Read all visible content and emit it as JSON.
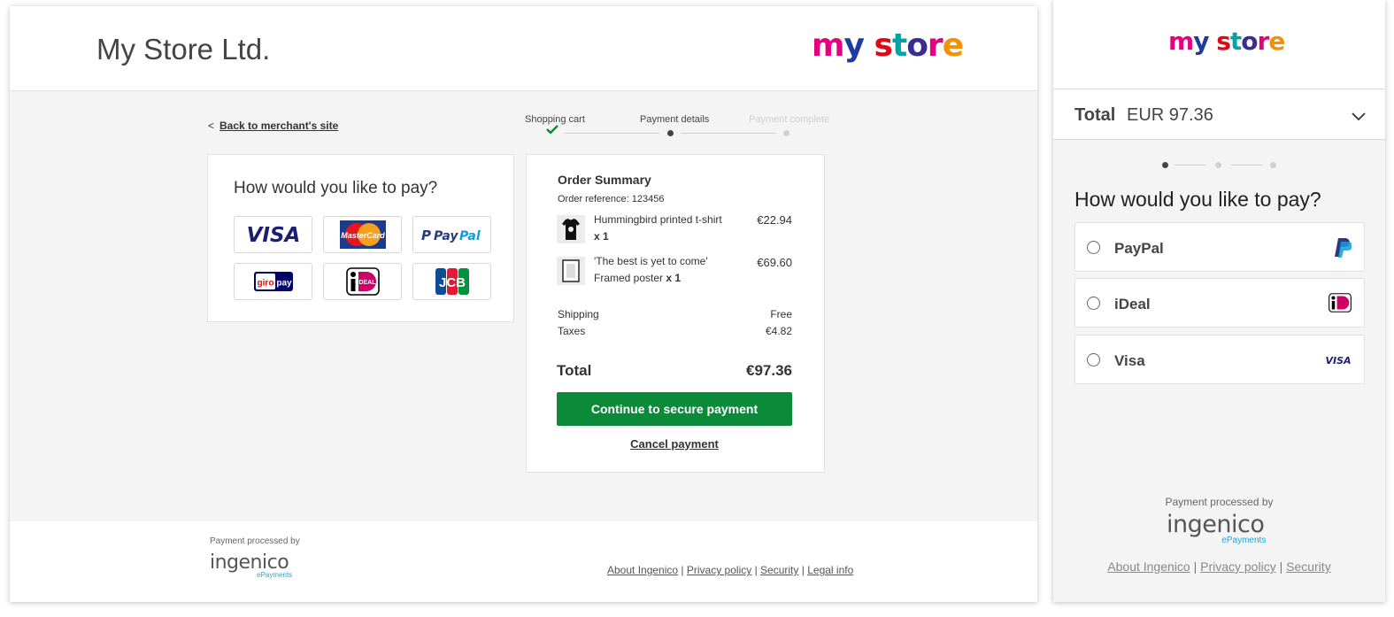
{
  "desktop": {
    "store_name": "My Store Ltd.",
    "logo": {
      "my": "my",
      "store": "store"
    },
    "back_link": {
      "arrow": "<",
      "label": "Back to merchant's site"
    },
    "steps": [
      {
        "label": "Shopping cart",
        "state": "done"
      },
      {
        "label": "Payment details",
        "state": "active"
      },
      {
        "label": "Payment complete",
        "state": "pending"
      }
    ],
    "payment": {
      "title": "How would you like to pay?",
      "methods": [
        {
          "name": "Visa",
          "icon": "visa-logo"
        },
        {
          "name": "MasterCard",
          "icon": "mastercard-logo",
          "text": "MasterCard"
        },
        {
          "name": "PayPal",
          "icon": "paypal-logo",
          "text": "PayPal"
        },
        {
          "name": "giropay",
          "icon": "giropay-logo",
          "text_a": "giro",
          "text_b": "pay"
        },
        {
          "name": "iDEAL",
          "icon": "ideal-logo",
          "text": "iDEAL"
        },
        {
          "name": "JCB",
          "icon": "jcb-logo",
          "text": "JCB"
        }
      ]
    },
    "summary": {
      "title": "Order Summary",
      "reference": "Order reference: 123456",
      "items": [
        {
          "name": "Hummingbird printed t-shirt",
          "qty": "x 1",
          "price": "€22.94",
          "icon": "tshirt-icon"
        },
        {
          "name_line1": "'The best is yet to come'",
          "name_line2": "Framed poster",
          "qty": "x 1",
          "price": "€69.60",
          "icon": "poster-icon"
        }
      ],
      "shipping_label": "Shipping",
      "shipping_value": "Free",
      "taxes_label": "Taxes",
      "taxes_value": "€4.82",
      "total_label": "Total",
      "total_value": "€97.36",
      "continue_label": "Continue to secure payment",
      "cancel_label": "Cancel payment"
    },
    "footer": {
      "processed_by": "Payment processed by",
      "ingenico": "ingenico",
      "epayments": "ePayments",
      "links": [
        "About Ingenico",
        "Privacy policy",
        "Security",
        "Legal info"
      ],
      "separator": "|"
    }
  },
  "mobile": {
    "logo": {
      "my": "my",
      "store": "store"
    },
    "total_label": "Total",
    "total_value": "EUR 97.36",
    "title": "How would you like to pay?",
    "options": [
      {
        "label": "PayPal",
        "icon": "paypal-icon"
      },
      {
        "label": "iDeal",
        "icon": "ideal-icon"
      },
      {
        "label": "Visa",
        "icon": "visa-icon",
        "icon_text": "VISA"
      }
    ],
    "processed_by": "Payment processed by",
    "ingenico": "ingenico",
    "epayments": "ePayments",
    "links": [
      "About Ingenico",
      "Privacy policy",
      "Security"
    ],
    "separator": "|"
  },
  "colors": {
    "primary_button": "#0b8a3a",
    "check": "#0b8a3a",
    "epayments": "#1aa8dc"
  }
}
